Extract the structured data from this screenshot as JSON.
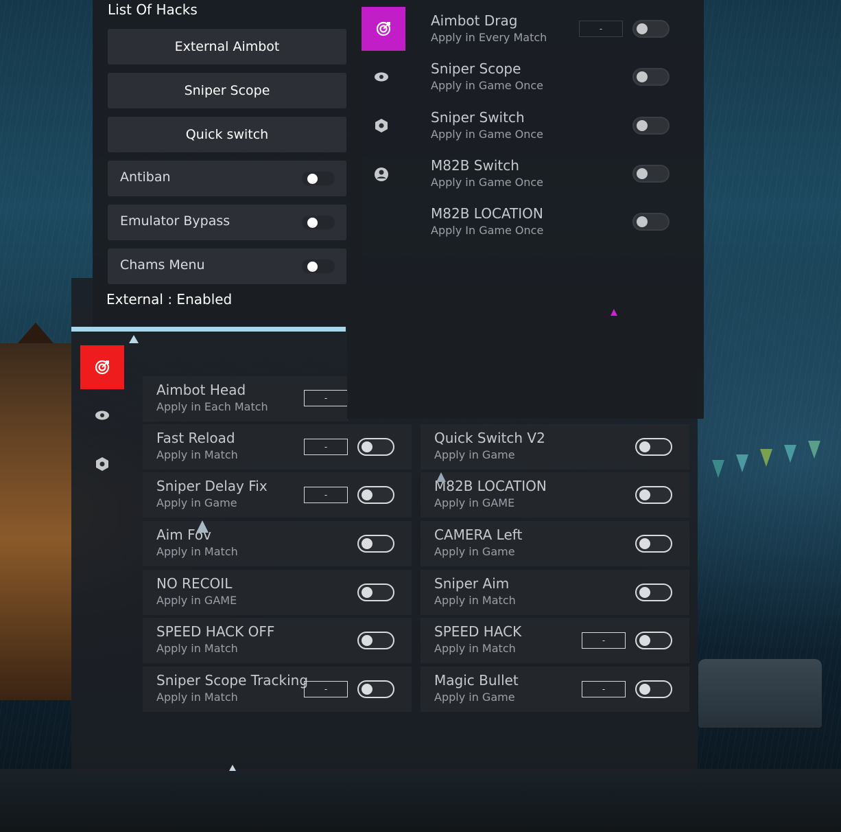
{
  "colors": {
    "accent_magenta": "#c21ec8",
    "accent_red": "#ee1c1c",
    "accent_bar": "#a9d6ea"
  },
  "list_panel": {
    "title": "List Of Hacks",
    "buttons": [
      "External Aimbot",
      "Sniper Scope",
      "Quick switch"
    ],
    "toggles": [
      {
        "label": "Antiban",
        "on": true
      },
      {
        "label": "Emulator Bypass",
        "on": true
      },
      {
        "label": "Chams Menu",
        "on": true
      }
    ],
    "status": "External : Enabled"
  },
  "top_panel": {
    "tabs": [
      {
        "icon": "target-icon",
        "active": true
      },
      {
        "icon": "eye-icon",
        "active": false
      },
      {
        "icon": "hexagon-icon",
        "active": false
      },
      {
        "icon": "user-icon",
        "active": false
      }
    ],
    "items": [
      {
        "title": "Aimbot Drag",
        "subtitle": "Apply in Every Match",
        "value": "-",
        "on": false
      },
      {
        "title": "Sniper Scope",
        "subtitle": "Apply in Game Once",
        "on": false
      },
      {
        "title": "Sniper Switch",
        "subtitle": "Apply in Game Once",
        "on": false
      },
      {
        "title": "M82B Switch",
        "subtitle": "Apply in Game Once",
        "on": false
      },
      {
        "title": "M82B LOCATION",
        "subtitle": "Apply In Game Once",
        "on": false
      }
    ]
  },
  "main_panel": {
    "tabs": [
      {
        "icon": "target-icon",
        "active": true
      },
      {
        "icon": "eye-icon",
        "active": false
      },
      {
        "icon": "hexagon-icon",
        "active": false
      }
    ],
    "left_items": [
      {
        "title": "Aimbot Head",
        "subtitle": "Apply in Each Match",
        "value": "-"
      },
      {
        "title": "Fast Reload",
        "subtitle": "Apply in Match",
        "value": "-",
        "on": false
      },
      {
        "title": "Sniper Delay Fix",
        "subtitle": "Apply in Game",
        "value": "-",
        "on": false
      },
      {
        "title": "Aim Fov",
        "subtitle": "Apply in Match",
        "on": false
      },
      {
        "title": "NO RECOIL",
        "subtitle": "Apply in GAME",
        "on": false
      },
      {
        "title": "SPEED HACK OFF",
        "subtitle": "Apply in Match",
        "on": false
      },
      {
        "title": "Sniper Scope Tracking",
        "subtitle": "Apply in Match",
        "value": "-",
        "on": false
      }
    ],
    "right_items": [
      {
        "title": "Quick Switch V2",
        "subtitle": "Apply in Game",
        "on": false
      },
      {
        "title": "M82B LOCATION",
        "subtitle": "Apply in GAME",
        "on": false
      },
      {
        "title": "CAMERA Left",
        "subtitle": "Apply in Game",
        "on": false
      },
      {
        "title": "Sniper Aim",
        "subtitle": "Apply in Match",
        "on": false
      },
      {
        "title": "SPEED HACK",
        "subtitle": "Apply in Match",
        "value": "-",
        "on": false
      },
      {
        "title": "Magic Bullet",
        "subtitle": "Apply in Game",
        "value": "-",
        "on": false
      }
    ]
  }
}
